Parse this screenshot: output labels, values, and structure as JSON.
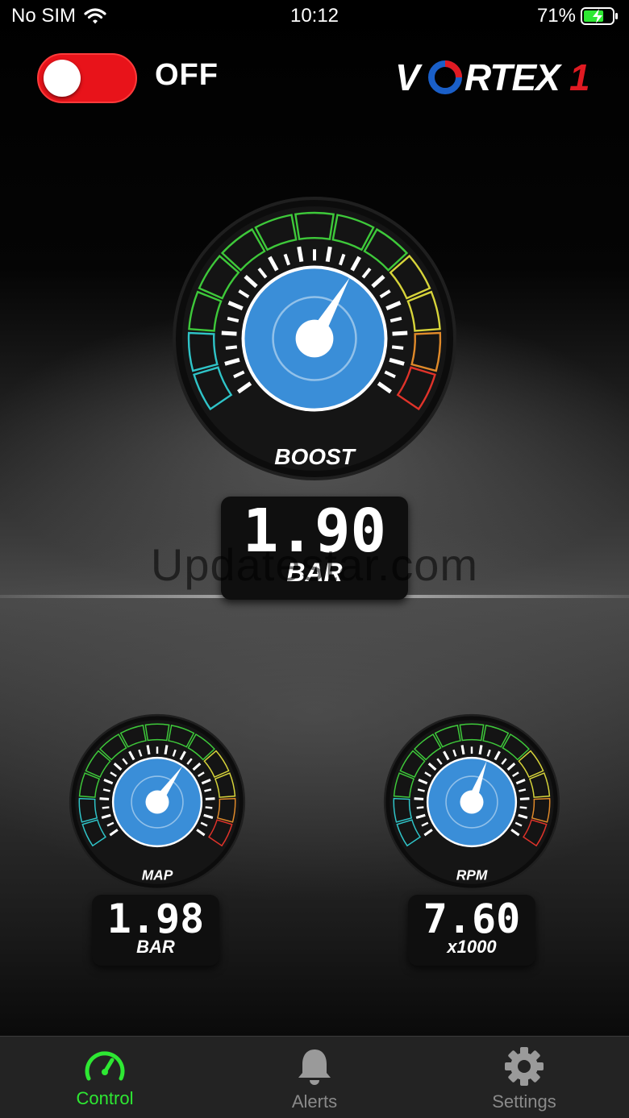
{
  "status_bar": {
    "carrier": "No SIM",
    "time": "10:12",
    "battery": "71%",
    "battery_level": 0.71
  },
  "power": {
    "state": "OFF",
    "on": false
  },
  "brand": {
    "logo": "VORTEX1"
  },
  "gauges": {
    "boost": {
      "label": "BOOST",
      "value": "1.90",
      "unit": "BAR",
      "needle_fraction": 0.62
    },
    "map": {
      "label": "MAP",
      "value": "1.98",
      "unit": "BAR",
      "needle_fraction": 0.64
    },
    "rpm": {
      "label": "RPM",
      "value": "7.60",
      "unit": "x1000",
      "needle_fraction": 0.58
    }
  },
  "watermark": "Updatestar.com",
  "tabs": [
    {
      "label": "Control",
      "icon": "speedometer-icon",
      "active": true
    },
    {
      "label": "Alerts",
      "icon": "bell-icon",
      "active": false
    },
    {
      "label": "Settings",
      "icon": "gear-icon",
      "active": false
    }
  ],
  "colors": {
    "accent": "#2ee833",
    "toggle_off": "#e8131a",
    "gauge_face": "#3a8ed8",
    "logo_blue": "#1a5fc8",
    "logo_red": "#e01a22"
  }
}
